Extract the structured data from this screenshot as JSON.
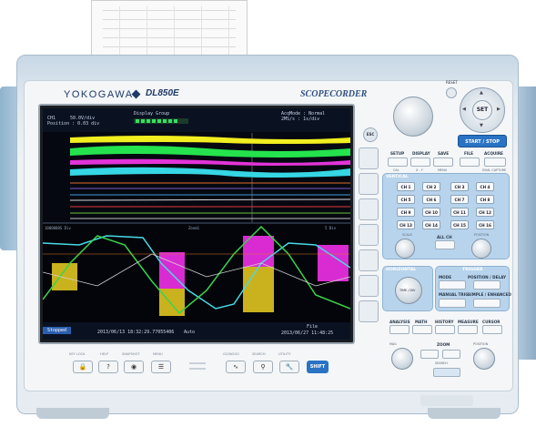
{
  "colors": {
    "accent_blue": "#2a73c4",
    "panel_blue": "#b8d4ec",
    "brand_navy": "#1e3a66"
  },
  "brand": {
    "maker": "YOKOGAWA",
    "model": "DL850E",
    "series": "SCOPECORDER"
  },
  "screen": {
    "top": {
      "ch_label": "CH1",
      "v_div": "50.0V/div",
      "position": "Position : 0.03 div",
      "display_group": "Display Group",
      "acq_mode": "AcqMode : Normal",
      "time_div": "2MS/s : 1s/div"
    },
    "zoom": {
      "z1": "Zoom1",
      "z2": "Zoom2",
      "scale_left": "1000000S Div",
      "scale_right": "5 Div"
    },
    "bottom": {
      "status": "Stopped",
      "start_time": "2013/06/13 18:32:29.77055406",
      "trigger": "Auto",
      "file_label": "File",
      "end_time": "2013/06/27 11:48:25"
    }
  },
  "softkeys": {
    "esc": "ESC"
  },
  "bottom_keys": [
    {
      "label": "KEY LOCK",
      "icon": "lock-icon"
    },
    {
      "label": "HELP",
      "icon": "question-icon"
    },
    {
      "label": "SNAPSHOT",
      "icon": "camera-icon"
    },
    {
      "label": "MENU",
      "icon": "menu-icon"
    },
    {
      "label": "GO/NOGO",
      "icon": "wave-icon"
    },
    {
      "label": "SEARCH",
      "icon": "search-icon"
    },
    {
      "label": "UTILITY",
      "icon": "wrench-icon"
    }
  ],
  "shift": "SHIFT",
  "panel": {
    "reset": "RESET",
    "set": "SET",
    "start_stop": "START / STOP",
    "row1": [
      "SETUP",
      "DISPLAY",
      "SAVE",
      "FILE",
      "ACQUIRE"
    ],
    "row1_sub": [
      "CAL",
      "X - Y",
      "MENU",
      "",
      "DUAL CAPTURE"
    ],
    "vertical": "VERTICAL",
    "channels": [
      "CH 1",
      "CH 2",
      "CH 3",
      "CH 4",
      "CH 5",
      "CH 6",
      "CH 7",
      "CH 8",
      "CH 9",
      "CH 10",
      "CH 11",
      "CH 12",
      "CH 13",
      "CH 14",
      "CH 15",
      "CH 16"
    ],
    "scale": "SCALE",
    "all_ch": "ALL CH",
    "position": "POSITION",
    "horizontal": "HORIZONTAL",
    "time_div": "TIME / DIV",
    "trigger": "TRIGGER",
    "mode": "MODE",
    "pos_delay": "POSITION / DELAY",
    "manual_trig": "MANUAL TRIG",
    "simple_enhanced": "SIMPLE / ENHANCED",
    "bottom_row": [
      "ANALYSIS",
      "MATH",
      "HISTORY",
      "MEASURE",
      "CURSOR"
    ],
    "zoom": "ZOOM",
    "search": "SEARCH",
    "zoom_pos": "POSITION",
    "mag": "MAG"
  }
}
